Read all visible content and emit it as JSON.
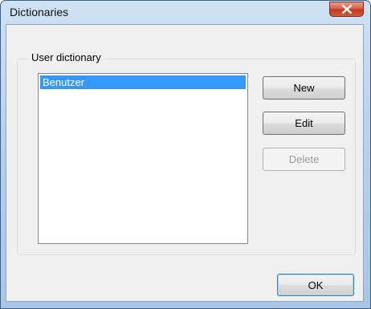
{
  "window": {
    "title": "Dictionaries"
  },
  "group": {
    "label": "User dictionary"
  },
  "dictionary_list": {
    "items": [
      "Benutzer"
    ],
    "selected_index": 0
  },
  "buttons": {
    "new_label": "New",
    "edit_label": "Edit",
    "delete_label": "Delete",
    "ok_label": "OK"
  },
  "colors": {
    "selection": "#3399ff",
    "close_button": "#c8412a",
    "dialog_face": "#f0f0f0"
  }
}
